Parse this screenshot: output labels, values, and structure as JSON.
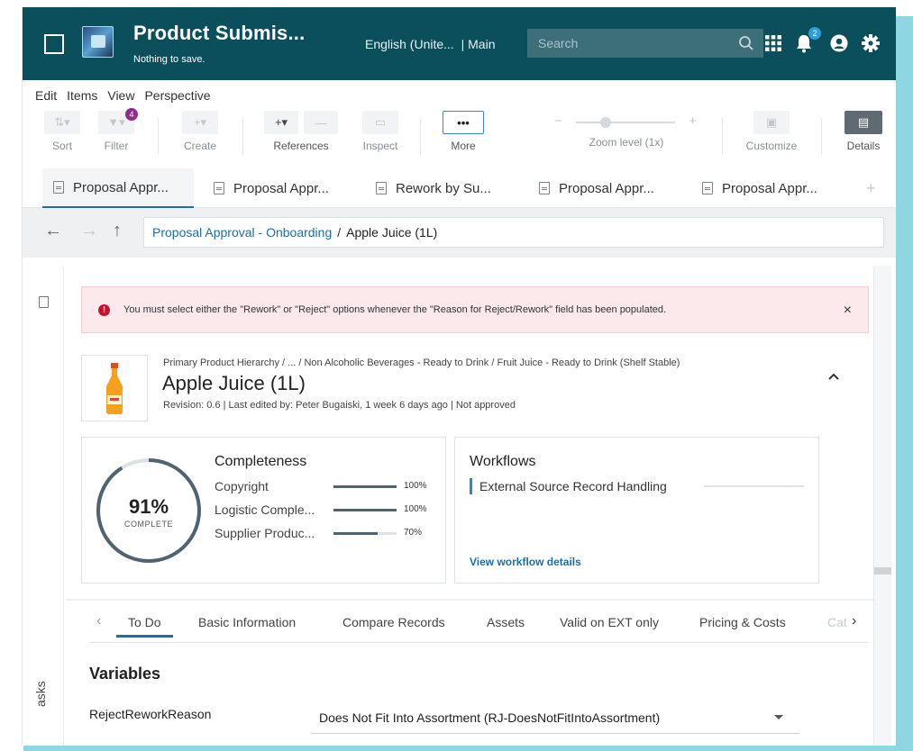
{
  "header": {
    "title": "Product Submis...",
    "subtitle": "Nothing to save.",
    "language": "English (Unite...",
    "workspace": "Main",
    "search_placeholder": "Search",
    "notification_count": "2"
  },
  "menu": [
    "Edit",
    "Items",
    "View",
    "Perspective"
  ],
  "toolbar": {
    "sort": "Sort",
    "filter": "Filter",
    "filter_badge": "4",
    "create": "Create",
    "references": "References",
    "inspect": "Inspect",
    "more": "More",
    "more_icon": "•••",
    "zoom": "Zoom level (1x)",
    "customize": "Customize",
    "details": "Details"
  },
  "tabs": [
    "Proposal Appr...",
    "Proposal Appr...",
    "Rework by Su...",
    "Proposal Appr...",
    "Proposal Appr..."
  ],
  "breadcrumb": {
    "link": "Proposal Approval - Onboarding",
    "separator": "/",
    "current": "Apple Juice (1L)"
  },
  "alert": {
    "message": "You must select either the \"Rework\" or \"Reject\" options whenever the \"Reason for Reject/Rework\" field has been populated.",
    "close": "×"
  },
  "product": {
    "hierarchy": "Primary Product Hierarchy / ... / Non Alcoholic Beverages - Ready to Drink / Fruit Juice - Ready to Drink (Shelf Stable)",
    "name": "Apple Juice (1L)",
    "revision": "Revision: 0.6 | Last edited by: Peter Bugaiski, 1 week 6 days ago | Not approved",
    "chevron": "^"
  },
  "completeness": {
    "title": "Completeness",
    "percent": "91%",
    "percent_value": 91,
    "caption": "COMPLETE",
    "metrics": [
      {
        "name": "Copyright",
        "value": "100%",
        "fraction": 1.0
      },
      {
        "name": "Logistic Comple...",
        "value": "100%",
        "fraction": 1.0
      },
      {
        "name": "Supplier Produc...",
        "value": "70%",
        "fraction": 0.7
      }
    ]
  },
  "workflows": {
    "title": "Workflows",
    "item": "External Source Record Handling",
    "link": "View workflow details"
  },
  "subtabs": {
    "items": [
      "To Do",
      "Basic Information",
      "Compare Records",
      "Assets",
      "Valid on EXT only",
      "Pricing & Costs",
      "Cat"
    ],
    "active": "To Do",
    "prev": "‹",
    "next": "›"
  },
  "variables": {
    "title": "Variables",
    "label": "RejectReworkReason",
    "selected": "Does Not Fit Into Assortment (RJ-DoesNotFitIntoAssortment)"
  },
  "rail": {
    "tasks": "asks"
  },
  "colors": {
    "header_bg": "#0b4f5c",
    "accent": "#1f6da6",
    "alert_bg": "#fbe9ec",
    "error": "#c8102e",
    "filter_badge": "#8d2f8a"
  }
}
